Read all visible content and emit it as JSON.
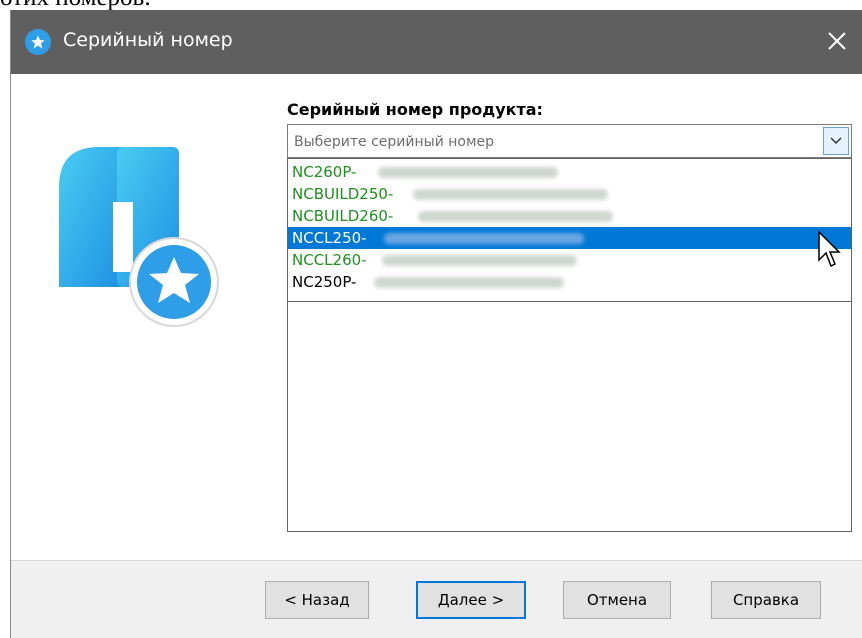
{
  "document": {
    "partial_text": "отих номеров."
  },
  "dialog": {
    "title": "Серийный номер",
    "field_label": "Серийный номер продукта:",
    "combo": {
      "placeholder": "Выберите серийный номер"
    },
    "options": [
      {
        "prefix": "NC260P-",
        "color": "#1f8f1f",
        "selected": false
      },
      {
        "prefix": "NCBUILD250-",
        "color": "#1f8f1f",
        "selected": false
      },
      {
        "prefix": "NCBUILD260-",
        "color": "#1f8f1f",
        "selected": false
      },
      {
        "prefix": "NCCL250-",
        "color": "#ffffff",
        "selected": true
      },
      {
        "prefix": "NCCL260-",
        "color": "#1f8f1f",
        "selected": false
      },
      {
        "prefix": "NC250P-",
        "color": "#000000",
        "selected": false
      }
    ],
    "buttons": {
      "back": "< Назад",
      "next": "Далее >",
      "cancel": "Отмена",
      "help": "Справка"
    }
  },
  "colors": {
    "accent": "#0078d7",
    "titlebar": "#5f5f5f",
    "logo_blue": "#2f9ee8"
  },
  "icons": {
    "title": "star-badge-icon",
    "close": "close-icon",
    "combo_arrow": "chevron-down-icon",
    "cursor": "mouse-cursor-icon"
  }
}
